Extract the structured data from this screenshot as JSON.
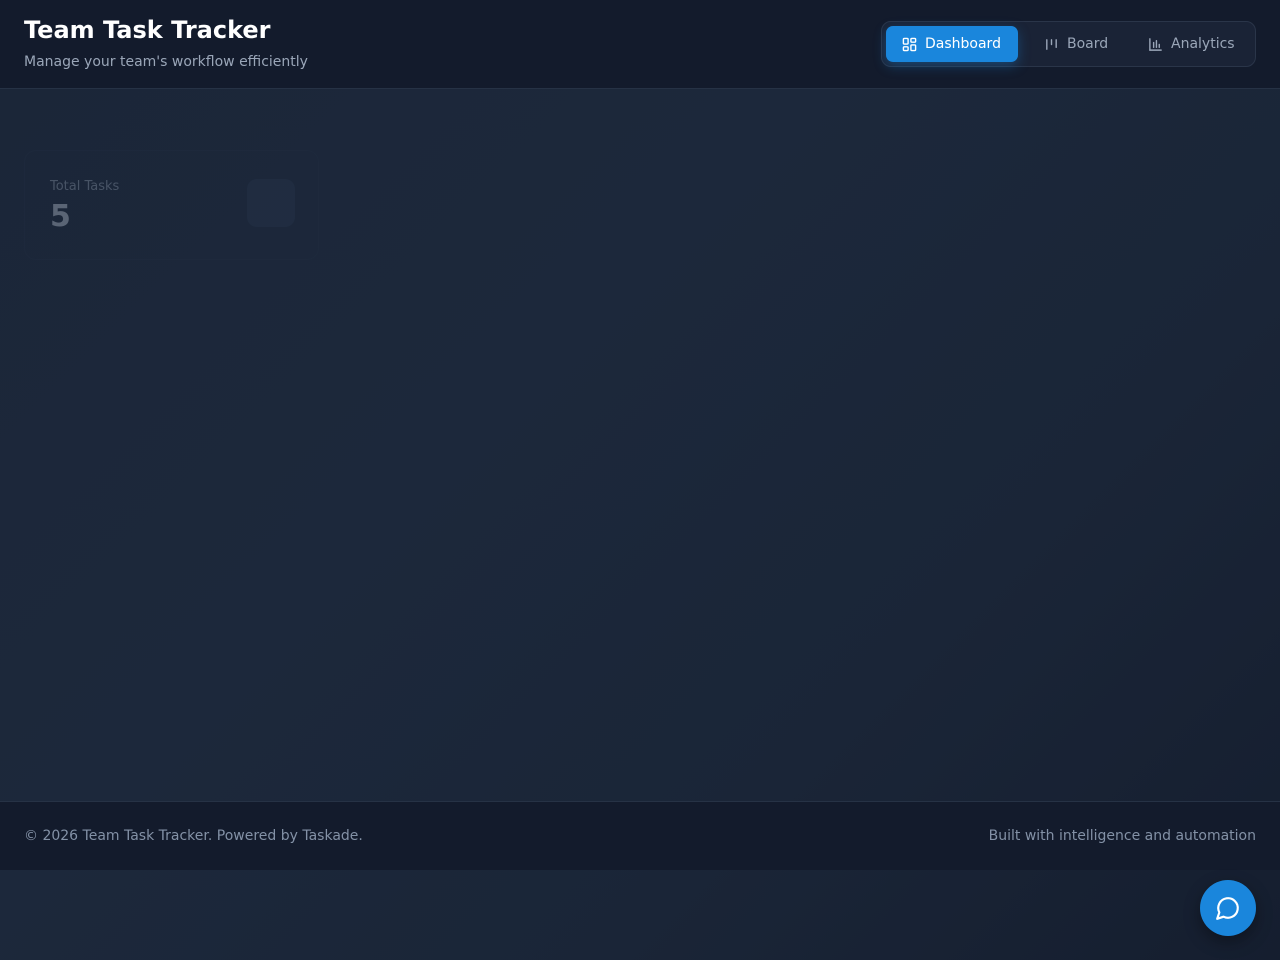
{
  "header": {
    "title": "Team Task Tracker",
    "subtitle": "Manage your team's workflow efficiently"
  },
  "nav": {
    "tabs": [
      {
        "label": "Dashboard",
        "icon": "grid-icon",
        "active": true
      },
      {
        "label": "Board",
        "icon": "board-columns-icon",
        "active": false
      },
      {
        "label": "Analytics",
        "icon": "bar-chart-icon",
        "active": false
      }
    ]
  },
  "stats": {
    "total_tasks_label": "Total Tasks",
    "total_tasks_value": "5"
  },
  "footer": {
    "left": "© 2026 Team Task Tracker. Powered by Taskade.",
    "right": "Built with intelligence and automation"
  },
  "chat": {
    "icon": "chat-bubble-icon"
  },
  "colors": {
    "accent": "#1a86dc",
    "header_bg": "#131b2c",
    "page_bg": "#1b2638"
  }
}
